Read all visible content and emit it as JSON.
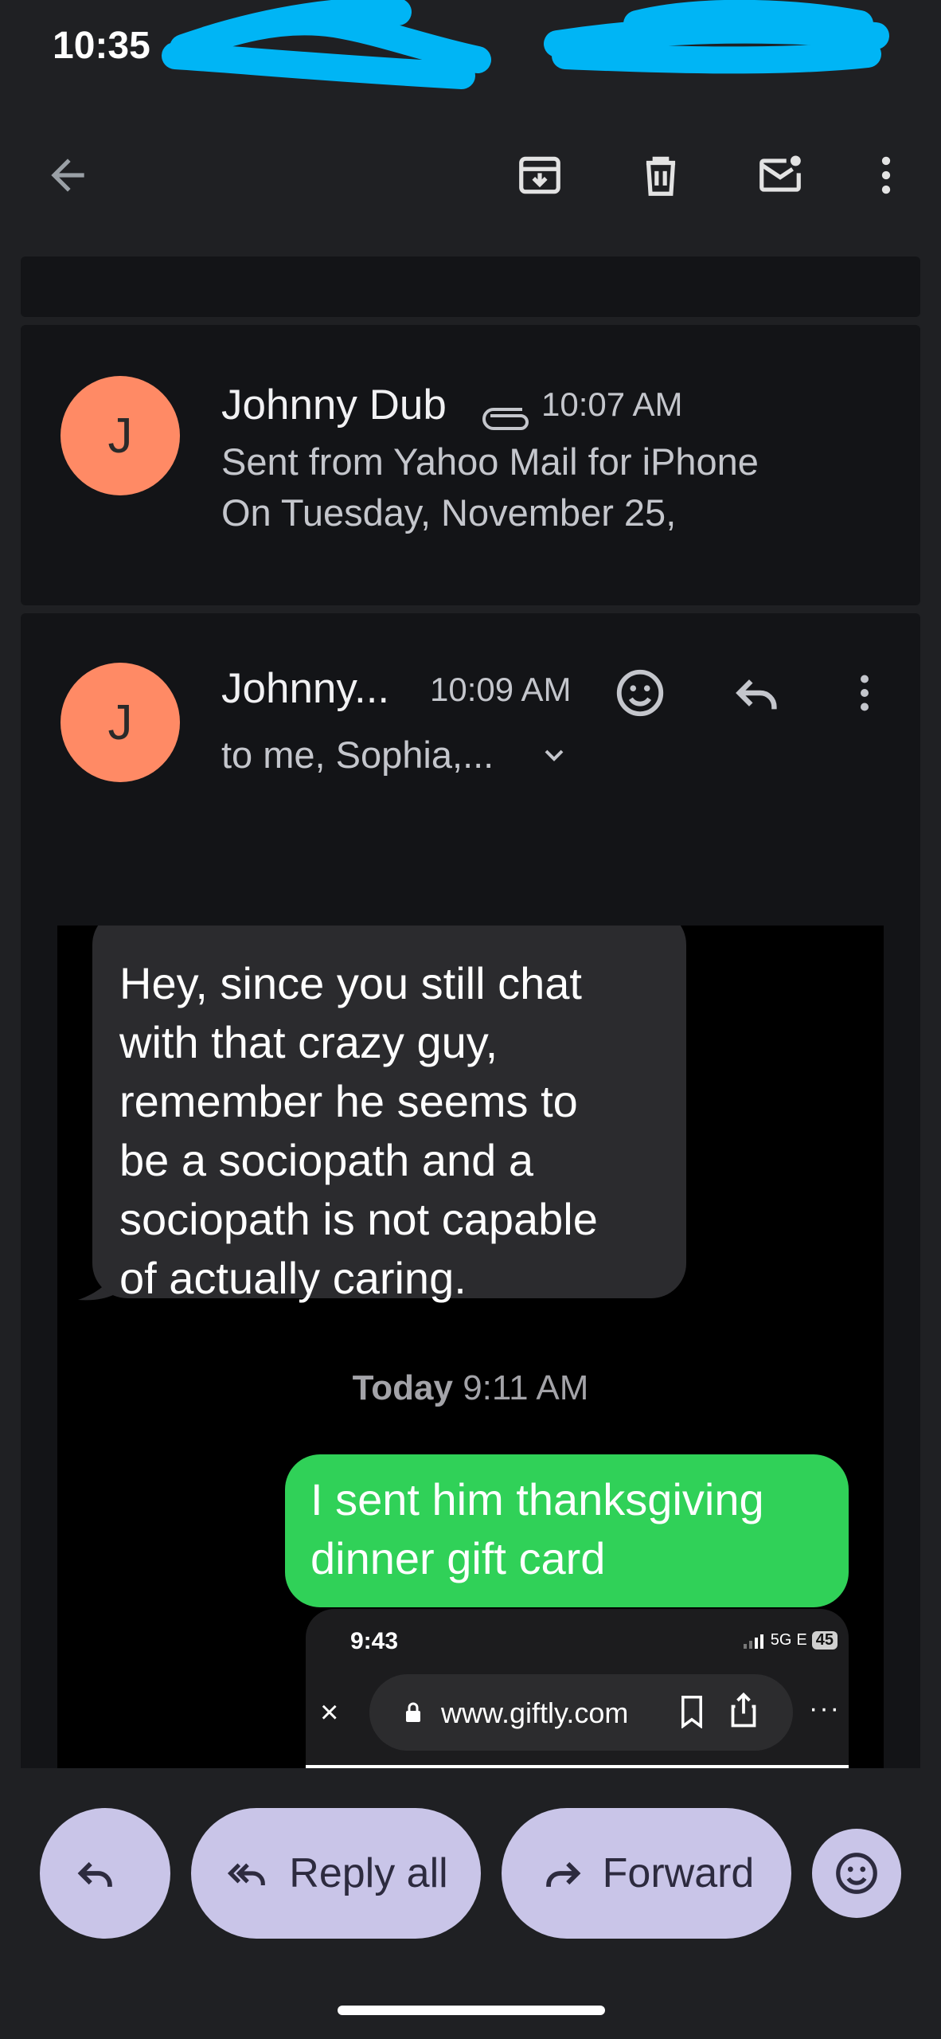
{
  "status_bar": {
    "time": "10:35"
  },
  "toolbar": {
    "back_icon": "arrow-left-icon",
    "archive_icon": "archive-icon",
    "delete_icon": "trash-icon",
    "mark_unread_icon": "mail-unread-icon",
    "more_icon": "more-vertical-icon"
  },
  "messages": [
    {
      "avatar_initial": "J",
      "sender": "Johnny Dub",
      "attachment_icon": "paperclip-icon",
      "time": "10:07 AM",
      "snippet_line1": "Sent from Yahoo Mail for iPhone",
      "snippet_line2": "On Tuesday, November 25,"
    },
    {
      "avatar_initial": "J",
      "sender": "Johnny...",
      "time": "10:09 AM",
      "recipients": "to me, Sophia,...",
      "emoji_icon": "emoji-icon",
      "reply_icon": "reply-icon",
      "more_icon": "more-vertical-icon"
    }
  ],
  "embedded_screenshot": {
    "incoming_bubble": "Hey, since you still chat\nwith that crazy guy,\nremember he seems to\nbe a sociopath and a\nsociopath is not capable\nof actually caring.",
    "timestamp_day": "Today",
    "timestamp_time": "9:11 AM",
    "outgoing_bubble": "I sent him thanksgiving\ndinner gift card",
    "phone": {
      "time": "9:43",
      "network": "5G",
      "network_suffix": "E",
      "battery": "45",
      "close": "×",
      "url": "www.giftly.com",
      "more": "···"
    }
  },
  "actions": {
    "reply_label": "",
    "reply_all_label": "Reply all",
    "forward_label": "Forward",
    "emoji_icon": "emoji-icon"
  },
  "colors": {
    "background": "#1f2023",
    "card": "#131417",
    "avatar": "#ff8a65",
    "pill": "#c9c5e8",
    "outgoing_bubble": "#30d158",
    "incoming_bubble": "#2b2b2e",
    "redaction": "#00b5f5"
  }
}
